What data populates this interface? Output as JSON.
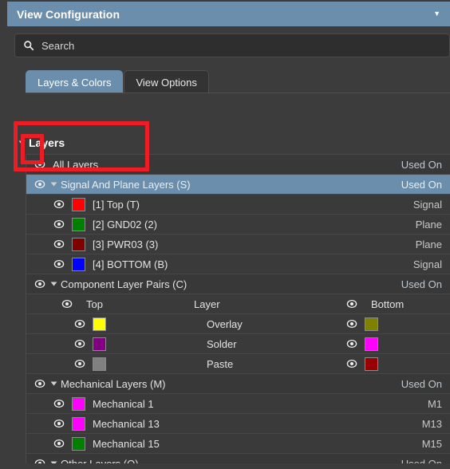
{
  "window": {
    "title": "View Configuration",
    "collapse_icon": "chevron-down-icon"
  },
  "search": {
    "placeholder": "Search",
    "value": "",
    "icon": "search-icon"
  },
  "tabs": [
    {
      "label": "Layers & Colors",
      "active": true
    },
    {
      "label": "View Options",
      "active": false
    }
  ],
  "section": {
    "title": "Layers",
    "expanded": true
  },
  "colors": {
    "accent": "#6a8eab",
    "annotation": "#ee1c25",
    "panel_bg": "#3c3c3c",
    "row_bg": "#3a3a3a",
    "text": "#e3e3e3"
  },
  "tree": {
    "columns": {
      "left": "Top",
      "middle": "Layer",
      "right": "Bottom"
    },
    "rows": [
      {
        "id": "all-layers",
        "type": "root",
        "indent": 0,
        "eye": true,
        "label": "All Layers",
        "right": "Used On",
        "selected": false
      },
      {
        "id": "signal-and-plane-layers",
        "type": "group",
        "indent": 1,
        "eye": true,
        "disclosure": true,
        "label": "Signal And Plane Layers (S)",
        "right": "Used On",
        "selected": true
      },
      {
        "id": "layer-top",
        "type": "layer",
        "indent": 2,
        "eye": true,
        "swatch": "#ff0000",
        "label": "[1] Top (T)",
        "right": "Signal"
      },
      {
        "id": "layer-gnd02",
        "type": "layer",
        "indent": 2,
        "eye": true,
        "swatch": "#008000",
        "label": "[2] GND02 (2)",
        "right": "Plane"
      },
      {
        "id": "layer-pwr03",
        "type": "layer",
        "indent": 2,
        "eye": true,
        "swatch": "#800000",
        "label": "[3] PWR03 (3)",
        "right": "Plane"
      },
      {
        "id": "layer-bottom",
        "type": "layer",
        "indent": 2,
        "eye": true,
        "swatch": "#0000ff",
        "label": "[4] BOTTOM (B)",
        "right": "Signal"
      },
      {
        "id": "component-layer-pairs",
        "type": "group",
        "indent": 1,
        "eye": true,
        "disclosure": true,
        "label": "Component Layer Pairs (C)",
        "right": "Used On"
      },
      {
        "id": "pair-header",
        "type": "pair-header",
        "left_eye": true,
        "left_label": "Top",
        "middle_label": "Layer",
        "right_eye": true,
        "right_label": "Bottom"
      },
      {
        "id": "pair-overlay",
        "type": "pair",
        "left_eye": true,
        "left_swatch": "#ffff00",
        "middle_label": "Overlay",
        "right_eye": true,
        "right_swatch": "#808000"
      },
      {
        "id": "pair-solder",
        "type": "pair",
        "left_eye": true,
        "left_swatch": "#800080",
        "middle_label": "Solder",
        "right_eye": true,
        "right_swatch": "#ff00ff"
      },
      {
        "id": "pair-paste",
        "type": "pair",
        "left_eye": true,
        "left_swatch": "#808080",
        "middle_label": "Paste",
        "right_eye": true,
        "right_swatch": "#990000"
      },
      {
        "id": "mechanical-layers",
        "type": "group",
        "indent": 1,
        "eye": true,
        "disclosure": true,
        "label": "Mechanical Layers (M)",
        "right": "Used On"
      },
      {
        "id": "mechanical-1",
        "type": "layer",
        "indent": 2,
        "eye": true,
        "swatch": "#ff00ff",
        "label": "Mechanical 1",
        "right": "M1"
      },
      {
        "id": "mechanical-13",
        "type": "layer",
        "indent": 2,
        "eye": true,
        "swatch": "#ff00ff",
        "label": "Mechanical 13",
        "right": "M13"
      },
      {
        "id": "mechanical-15",
        "type": "layer",
        "indent": 2,
        "eye": true,
        "swatch": "#008000",
        "label": "Mechanical 15",
        "right": "M15"
      },
      {
        "id": "other-layers",
        "type": "group",
        "indent": 1,
        "eye": true,
        "disclosure": true,
        "label": "Other Layers (O)",
        "right": "Used On"
      }
    ]
  },
  "annotations": [
    {
      "name": "highlight-all-layers-row",
      "shape": "rectangle",
      "color": "#ee1c25"
    },
    {
      "name": "highlight-all-layers-eye-toggle",
      "shape": "rectangle",
      "color": "#ee1c25"
    }
  ]
}
